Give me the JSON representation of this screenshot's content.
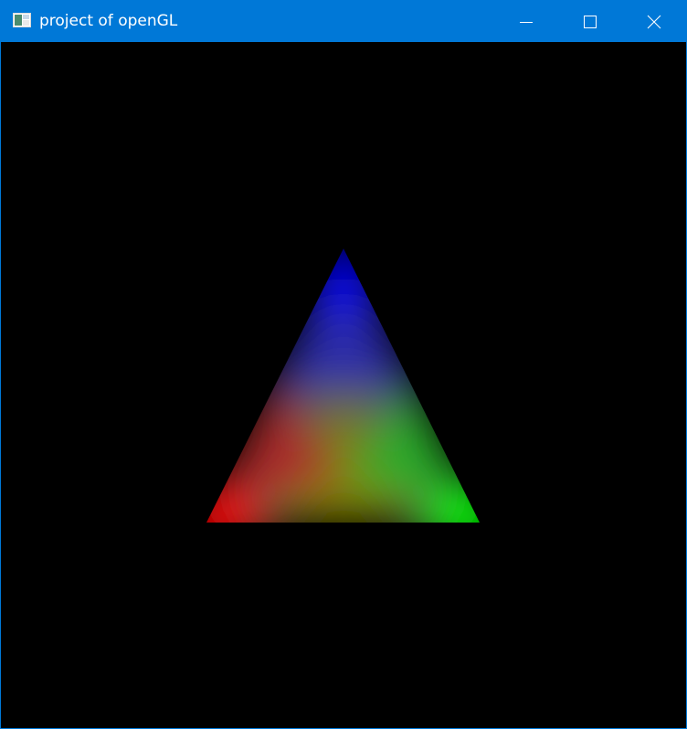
{
  "window": {
    "title": "project of openGL",
    "titlebar_color": "#0078d7",
    "background_color": "#000000"
  },
  "controls": {
    "minimize_icon": "minimize-icon",
    "maximize_icon": "maximize-icon",
    "close_icon": "close-icon"
  },
  "scene": {
    "shape": "triangle",
    "vertex_colors": {
      "top": "#0000ff",
      "bottom_left": "#ff0000",
      "bottom_right": "#00ff00"
    }
  }
}
